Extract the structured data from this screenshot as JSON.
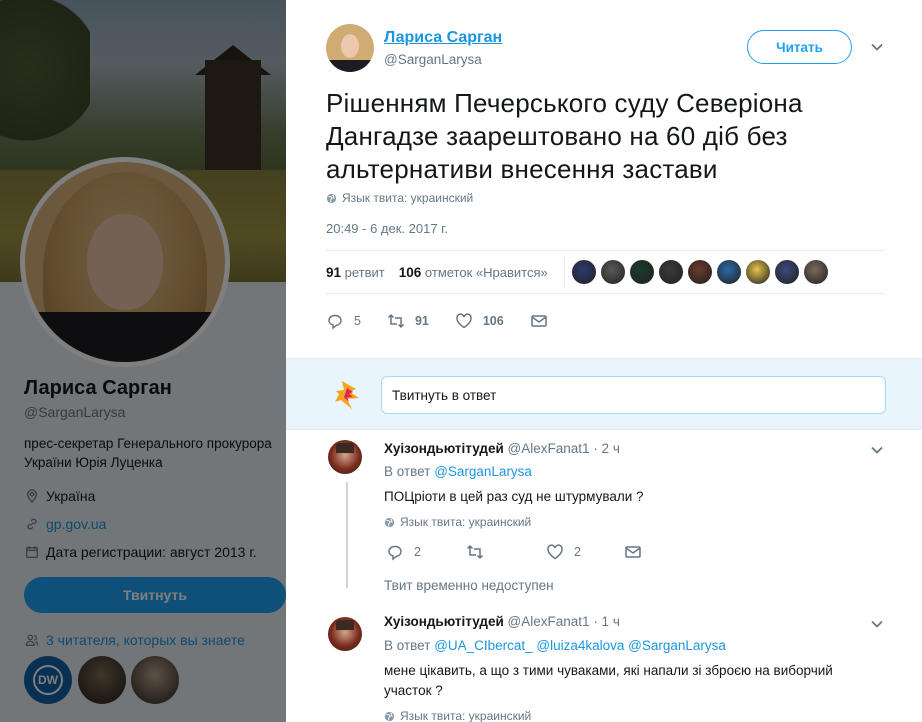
{
  "profile": {
    "name": "Лариса Сарган",
    "handle": "@SarganLarysa",
    "bio": "прес-секретар Генерального прокурора України Юрія Луценка",
    "bio_line1": "прес-секретар Генерального прокурора",
    "bio_line2": "України Юрія Луценка",
    "location": "Україна",
    "url": "gp.gov.ua",
    "joined": "Дата регистрации: август 2013 г.",
    "tweet_button": "Твитнуть",
    "followers_you_know": "3 читателя, которых вы знаете",
    "dw_badge": "DW"
  },
  "tweet": {
    "author_name": "Лариса Сарган",
    "author_handle": "@SarganLarysa",
    "follow_label": "Читать",
    "text": "Рішенням Печерського суду Северіона Дангадзе заарештовано на 60 діб без альтернативи внесення застави",
    "language": "Язык твита: украинский",
    "timestamp": "20:49 - 6 дек. 2017 г.",
    "retweets_count": "91",
    "retweets_label": "ретвит",
    "likes_count": "106",
    "likes_label": "отметок «Нравится»",
    "actions": {
      "replies": "5",
      "retweets": "91",
      "likes": "106"
    },
    "likers": [
      "#2b3b6e",
      "#5a5a5a",
      "#1b3a2a",
      "#3a3a3a",
      "#6b3a2a",
      "#2a6aa8",
      "#e8c24a",
      "#3a4a7a",
      "#7a6a5a"
    ]
  },
  "composer": {
    "placeholder": "Твитнуть в ответ"
  },
  "replies": [
    {
      "name": "Хуізондьютітудей",
      "handle": "@AlexFanat1",
      "time": "· 2 ч",
      "reply_to_label": "В ответ",
      "mentions": "@SarganLarysa",
      "text": "ПОЦріоти в цей раз суд не штурмували ?",
      "language": "Язык твита: украинский",
      "actions": {
        "replies": "2",
        "retweets": "",
        "likes": "2"
      }
    },
    {
      "name": "Хуізондьютітудей",
      "handle": "@AlexFanat1",
      "time": "· 1 ч",
      "reply_to_label": "В ответ",
      "mentions": "@UA_CIbercat_ @luiza4kalova @SarganLarysa",
      "text": "мене цікавить, а що з тими чуваками, які напали зі зброєю на виборчий участок ?",
      "language": "Язык твита: украинский"
    }
  ],
  "unavailable_text": "Твит временно недоступен",
  "colors": {
    "accent": "#1da1f2",
    "link": "#1b95e0",
    "muted": "#657786"
  }
}
